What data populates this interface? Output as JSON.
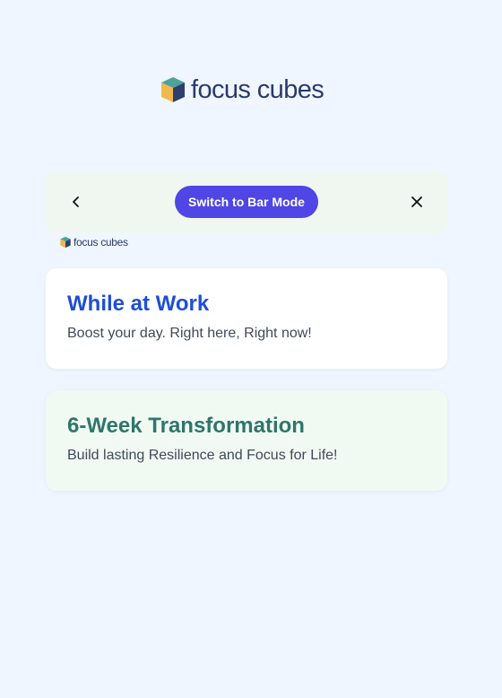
{
  "brand": {
    "name": "focus cubes"
  },
  "toolbar": {
    "back_icon": "chevron-left-icon",
    "switch_label": "Switch to Bar Mode",
    "close_icon": "close-icon"
  },
  "colors": {
    "background": "#eff6ff",
    "toolbar_bg": "#f0f7f1",
    "accent": "#4f46e5",
    "work_title": "#1d4ed8",
    "transform_title": "#2f766a",
    "transform_bg": "#f0faf3"
  },
  "cards": [
    {
      "title": "While at Work",
      "description": "Boost your day. Right here, Right now!"
    },
    {
      "title": "6-Week Transformation",
      "description": "Build lasting Resilience and Focus for Life!"
    }
  ]
}
